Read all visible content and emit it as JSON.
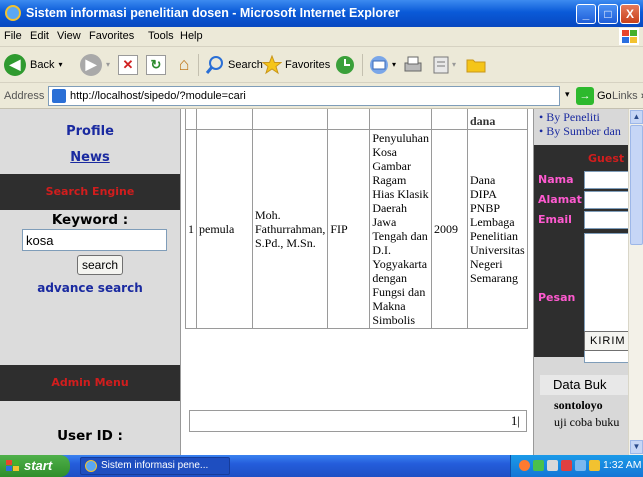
{
  "window": {
    "title": "Sistem informasi penelitian dosen - Microsoft Internet Explorer",
    "min_glyph": "_",
    "max_glyph": "□",
    "close_glyph": "X"
  },
  "menubar": {
    "items": [
      "File",
      "Edit",
      "View",
      "Favorites",
      "Tools",
      "Help"
    ]
  },
  "toolbar": {
    "back_label": "Back",
    "search_label": "Search",
    "favorites_label": "Favorites",
    "back_glyph": "◀",
    "forward_glyph": "▶",
    "stop_glyph": "✕",
    "refresh_glyph": "↻",
    "home_glyph": "⌂",
    "dropdown_glyph": "▾"
  },
  "address": {
    "label": "Address",
    "url": "http://localhost/sipedo/?module=cari",
    "go_label": "Go",
    "links_label": "Links",
    "links_glyph": "»",
    "dropdown_glyph": "▾",
    "go_glyph": "→"
  },
  "left_menu": {
    "profile": "Profile",
    "news": "News",
    "search_engine": "Search Engine",
    "keyword_label": "Keyword :",
    "keyword_value": "kosa",
    "search_button": "search",
    "advance_search": "advance search",
    "admin_menu": "Admin Menu",
    "user_id_label": "User ID :"
  },
  "results": {
    "partial_header_last": "dana",
    "row": {
      "no": "1",
      "category": "pemula",
      "researcher_lines": [
        "Moh.",
        "Fathurrahman,",
        "S.Pd., M.Sn."
      ],
      "faculty": "FIP",
      "title_lines": [
        "Penyuluhan",
        "Kosa",
        "Gambar",
        "Ragam",
        "Hias Klasik",
        "Daerah",
        "Jawa",
        "Tengah dan",
        "D.I.",
        "Yogyakarta",
        "dengan",
        "Fungsi dan",
        "Makna",
        "Simbolis"
      ],
      "year": "2009",
      "fund_lines": [
        "Dana",
        "DIPA",
        "PNBP",
        "Lembaga",
        "Penelitian",
        "Universitas",
        "Negeri",
        "Semarang"
      ]
    },
    "page": "1|"
  },
  "right_panel": {
    "by_peneliti": "By Peneliti",
    "by_sumber": "By Sumber dan",
    "guest_title": "Guest",
    "nama_label": "Nama",
    "alamat_label": "Alamat",
    "email_label": "Email",
    "pesan_label": "Pesan",
    "kirim_button": "KIRIM",
    "data_buku_title": "Data Buk",
    "books": [
      "sontoloyo",
      "uji coba buku"
    ],
    "bullet_glyph": "•"
  },
  "scrollbar": {
    "up_glyph": "▲",
    "down_glyph": "▼"
  },
  "taskbar": {
    "start_label": "start",
    "task_label": "Sistem informasi pene...",
    "clock": "1:32 AM"
  },
  "colors": {
    "title_bar": "#0a5ad8",
    "link_blue": "#1a2aa0",
    "band_dark": "#2e2e2e",
    "band_red": "#d21d1d",
    "form_pink": "#ff5ad0",
    "start_green": "#3fa03a"
  }
}
